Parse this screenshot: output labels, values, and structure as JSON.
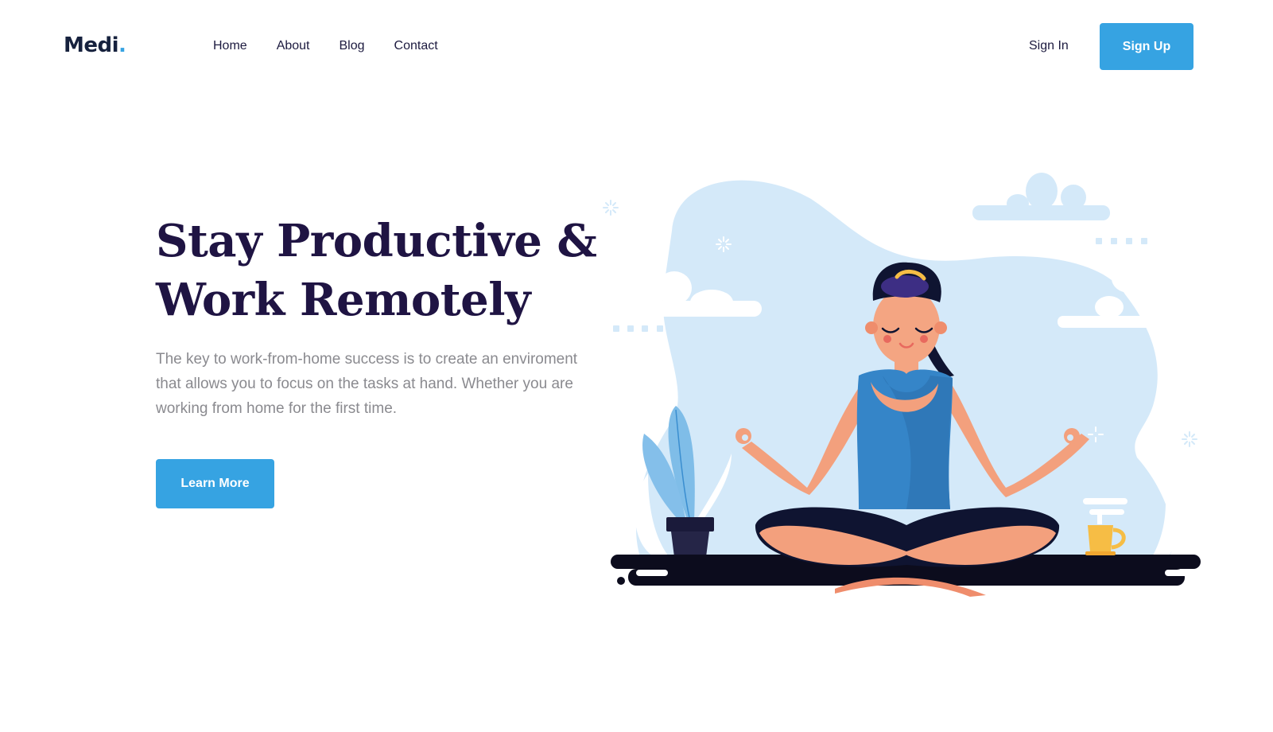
{
  "header": {
    "logo_text": "Medi",
    "logo_dot": ".",
    "nav": [
      "Home",
      "About",
      "Blog",
      "Contact"
    ],
    "signin_label": "Sign In",
    "signup_label": "Sign Up"
  },
  "hero": {
    "title_line1": "Stay Productive &",
    "title_line2": "Work Remotely",
    "description": "The key to work-from-home success is to create an enviroment that allows you to focus on the tasks at hand. Whether you are working from home for the first time.",
    "cta_label": "Learn More"
  },
  "illustration": {
    "subject": "meditating-woman-illustration"
  },
  "colors": {
    "accent": "#36a3e2",
    "heading": "#1f1443",
    "body_text": "#8a8a8f",
    "blob": "#d4e9f9",
    "floor": "#0c0c1d"
  }
}
